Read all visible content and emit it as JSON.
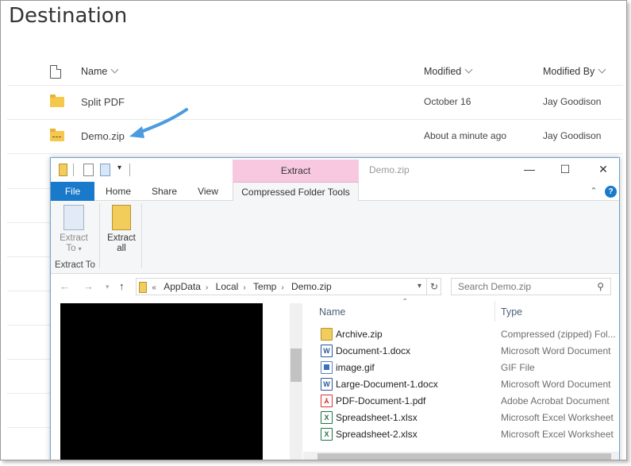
{
  "sharepoint": {
    "title": "Destination",
    "columns": {
      "name": "Name",
      "modified": "Modified",
      "modified_by": "Modified By"
    },
    "rows": [
      {
        "name": "Split PDF",
        "modified": "October 16",
        "modified_by": "Jay Goodison",
        "icon": "folder-icon"
      },
      {
        "name": "Demo.zip",
        "modified": "About a minute ago",
        "modified_by": "Jay Goodison",
        "icon": "zip-folder-icon"
      }
    ]
  },
  "annotation": {
    "arrow_color": "#4a9be0"
  },
  "explorer": {
    "window_title": "Demo.zip",
    "context_tab_header": "Extract",
    "context_color": "#f7c8e0",
    "tabs": {
      "file": "File",
      "home": "Home",
      "share": "Share",
      "view": "View",
      "compressed": "Compressed Folder Tools"
    },
    "ribbon": {
      "extract_to_line1": "Extract",
      "extract_to_line2": "To",
      "extract_all_line1": "Extract",
      "extract_all_line2": "all",
      "group_label": "Extract To"
    },
    "address": {
      "prefix": "«",
      "crumbs": [
        "AppData",
        "Local",
        "Temp",
        "Demo.zip"
      ]
    },
    "search_placeholder": "Search Demo.zip",
    "file_columns": {
      "name": "Name",
      "type": "Type"
    },
    "files": [
      {
        "name": "Archive.zip",
        "type": "Compressed (zipped) Fol...",
        "icon": "zip"
      },
      {
        "name": "Document-1.docx",
        "type": "Microsoft Word Document",
        "icon": "word"
      },
      {
        "name": "image.gif",
        "type": "GIF File",
        "icon": "gif"
      },
      {
        "name": "Large-Document-1.docx",
        "type": "Microsoft Word Document",
        "icon": "word"
      },
      {
        "name": "PDF-Document-1.pdf",
        "type": "Adobe Acrobat Document",
        "icon": "pdf"
      },
      {
        "name": "Spreadsheet-1.xlsx",
        "type": "Microsoft Excel Worksheet",
        "icon": "excel"
      },
      {
        "name": "Spreadsheet-2.xlsx",
        "type": "Microsoft Excel Worksheet",
        "icon": "excel"
      }
    ]
  },
  "colors": {
    "file_tab": "#1979ca",
    "accent_blue": "#0078d7"
  }
}
